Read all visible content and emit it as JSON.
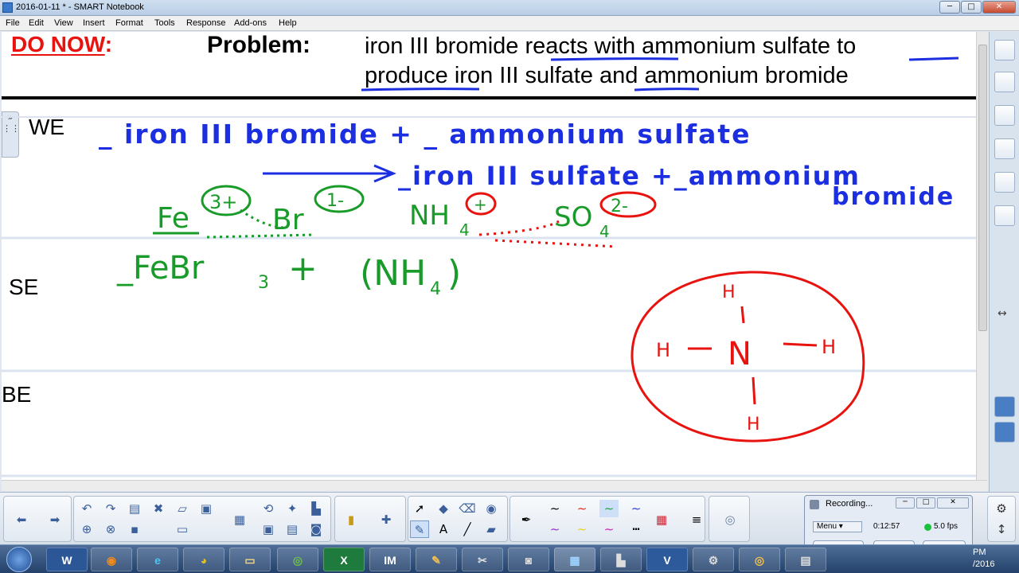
{
  "window": {
    "title": "2016-01-11 * - SMART Notebook",
    "min_label": "─",
    "max_label": "□",
    "close_label": "✕"
  },
  "menu": [
    "File",
    "Edit",
    "View",
    "Insert",
    "Format",
    "Tools",
    "Response",
    "Add-ons",
    "Help"
  ],
  "page": {
    "do_now_label": "DO NOW",
    "do_now_colon": ":",
    "problem_label": "Problem:",
    "problem_line1": "iron III bromide reacts with ammonium sulfate to",
    "problem_line2": "produce iron III sulfate and ammonium bromide",
    "row_labels": {
      "we": "WE",
      "se": "SE",
      "be": "BE"
    }
  },
  "handwriting": {
    "blue_line1": "_ iron III bromide + _ ammonium sulfate",
    "blue_line2": "_iron III sulfate +_ammonium",
    "blue_line3": "bromide",
    "green_fe": "Fe",
    "green_fe_charge": "3+",
    "green_br": "Br",
    "green_br_charge": "1-",
    "green_nh": "NH",
    "green_nh_sub": "4",
    "green_nh_charge": "+",
    "green_so": "SO",
    "green_so_sub": "4",
    "green_so_charge": "2-",
    "green_formula_1": "_FeBr",
    "green_formula_1_sub": "3",
    "green_formula_plus": "+",
    "green_formula_2": "(NH",
    "green_formula_2_sub": "4",
    "green_formula_2_close": ")",
    "red_center": "N",
    "red_h_top": "H",
    "red_h_left": "H",
    "red_h_right": "H",
    "red_h_bottom": "H"
  },
  "recording": {
    "title": "Recording...",
    "menu": "Menu",
    "time": "0:12:57",
    "fps": "5.0 fps"
  },
  "taskbar": {
    "clock_time": "PM",
    "clock_date": "/2016"
  },
  "colors": {
    "blue_ink": "#1b2fe0",
    "green_ink": "#199b2a",
    "red_ink": "#e8130f",
    "donow_red": "#e8130f"
  }
}
